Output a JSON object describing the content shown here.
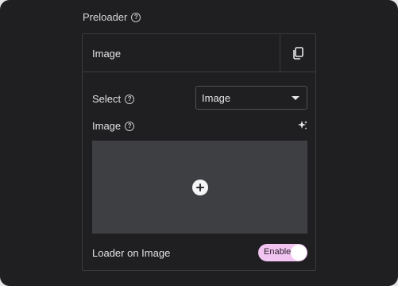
{
  "section": {
    "title": "Preloader",
    "help_icon": "help-icon"
  },
  "panel": {
    "header_title": "Image",
    "duplicate_icon": "duplicate-icon"
  },
  "select_row": {
    "label": "Select",
    "value": "Image"
  },
  "image_row": {
    "label": "Image",
    "ai_icon": "sparkles-icon"
  },
  "dropzone": {
    "add_icon": "plus-icon"
  },
  "loader_row": {
    "label": "Loader on Image",
    "toggle_label": "Enable",
    "toggle_on": true
  },
  "colors": {
    "background": "#1f1f22",
    "toggle": "#f2c4f2",
    "dropzone": "#3d3f43"
  }
}
